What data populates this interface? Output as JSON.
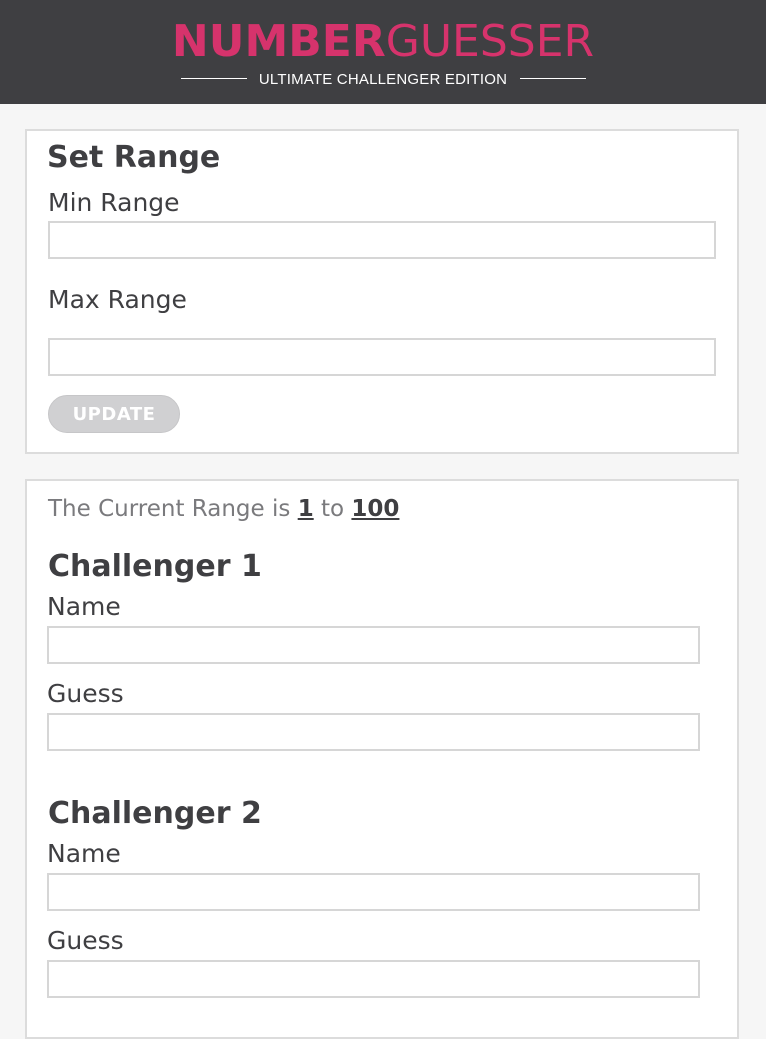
{
  "header": {
    "logo_bold": "NUMBER",
    "logo_light": "GUESSER",
    "tagline": "ULTIMATE CHALLENGER EDITION"
  },
  "set_range": {
    "title": "Set Range",
    "min_label": "Min Range",
    "min_value": "",
    "max_label": "Max Range",
    "max_value": "",
    "update_label": "UPDATE"
  },
  "current_range": {
    "prefix": "The Current Range is",
    "min": "1",
    "connector": "to",
    "max": "100"
  },
  "challengers": [
    {
      "title": "Challenger 1",
      "name_label": "Name",
      "name_value": "",
      "guess_label": "Guess",
      "guess_value": ""
    },
    {
      "title": "Challenger 2",
      "name_label": "Name",
      "name_value": "",
      "guess_label": "Guess",
      "guess_value": ""
    }
  ],
  "colors": {
    "header_bg": "#3f3f42",
    "accent": "#d6336c",
    "page_bg": "#f6f6f6",
    "button_disabled": "#d0d0d2"
  }
}
